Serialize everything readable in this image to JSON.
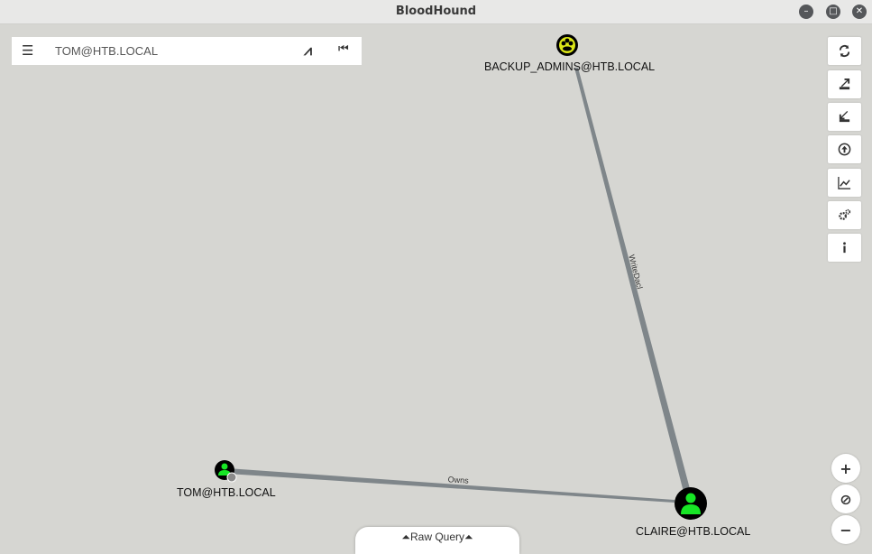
{
  "window": {
    "title": "BloodHound"
  },
  "search": {
    "value": "TOM@HTB.LOCAL"
  },
  "graph": {
    "nodes": [
      {
        "label": "BACKUP_ADMINS@HTB.LOCAL",
        "type": "group"
      },
      {
        "label": "CLAIRE@HTB.LOCAL",
        "type": "user"
      },
      {
        "label": "TOM@HTB.LOCAL",
        "type": "user",
        "owned": true
      }
    ],
    "edges": [
      {
        "label": "WriteDacl",
        "from": "CLAIRE@HTB.LOCAL",
        "to": "BACKUP_ADMINS@HTB.LOCAL"
      },
      {
        "label": "Owns",
        "from": "TOM@HTB.LOCAL",
        "to": "CLAIRE@HTB.LOCAL"
      }
    ]
  },
  "toolbar": [
    "refresh-icon",
    "export-icon",
    "import-icon",
    "upload-icon",
    "chart-icon",
    "settings-icon",
    "info-icon"
  ],
  "zoom": {
    "in": "+",
    "reset": "⊘",
    "out": "−"
  },
  "raw_query": {
    "label": "Raw Query"
  },
  "colors": {
    "user": "#17e625",
    "group": "#dbe617",
    "node_bg": "#000000",
    "edge": "#7f868a"
  }
}
